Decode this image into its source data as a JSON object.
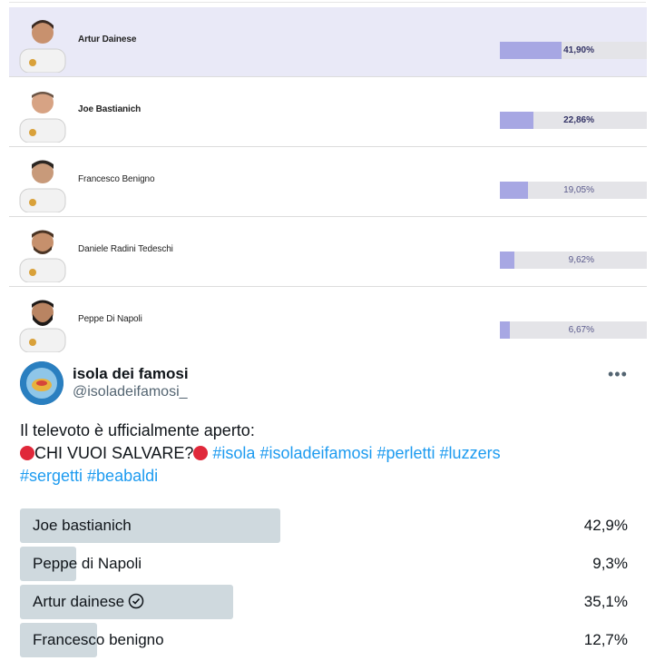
{
  "top_poll": {
    "rows": [
      {
        "name": "Artur Dainese",
        "pct": "41,90%",
        "fraction": 0.419
      },
      {
        "name": "Joe Bastianich",
        "pct": "22,86%",
        "fraction": 0.2286
      },
      {
        "name": "Francesco Benigno",
        "pct": "19,05%",
        "fraction": 0.1905
      },
      {
        "name": "Daniele Radini Tedeschi",
        "pct": "9,62%",
        "fraction": 0.0962
      },
      {
        "name": "Peppe Di Napoli",
        "pct": "6,67%",
        "fraction": 0.0667
      }
    ],
    "bar_color": "#a7a7e3",
    "track_color": "#e4e4e8",
    "highlight_color": "#e9e9f7"
  },
  "tweet": {
    "display_name": "isola dei famosi",
    "handle": "@isoladeifamosi_",
    "more_icon": "more-icon",
    "text_line1": "Il televoto è ufficialmente aperto:",
    "text_question": "CHI VUOI SALVARE?",
    "hashtags_line2": "#isola #isoladeifamosi #perletti #luzzers",
    "hashtags_line3": "#sergetti #beabaldi",
    "dot_color": "#e0283a",
    "options": [
      {
        "label": "Joe bastianich",
        "pct": "42,9%",
        "fraction": 0.429,
        "selected": false
      },
      {
        "label": "Peppe di Napoli",
        "pct": "9,3%",
        "fraction": 0.093,
        "selected": false
      },
      {
        "label": "Artur dainese",
        "pct": "35,1%",
        "fraction": 0.351,
        "selected": true
      },
      {
        "label": "Francesco benigno",
        "pct": "12,7%",
        "fraction": 0.127,
        "selected": false
      }
    ],
    "bar_color": "#cfd9de",
    "link_color": "#1d9bf0"
  }
}
